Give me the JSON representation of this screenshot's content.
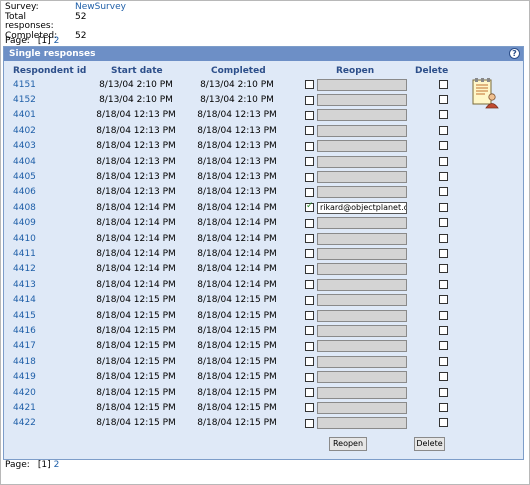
{
  "survey": {
    "survey_label": "Survey:",
    "survey_name": "NewSurvey",
    "total_label": "Total responses:",
    "total_value": "52",
    "completed_label": "Completed:",
    "completed_value": "52"
  },
  "pager_top": {
    "label": "Page:",
    "current": "[1]",
    "next": "2"
  },
  "pager_bottom": {
    "label": "Page:",
    "current": "[1]",
    "next": "2"
  },
  "panel": {
    "title": "Single responses",
    "help_icon": "?"
  },
  "columns": {
    "id": "Respondent id",
    "start": "Start date",
    "completed": "Completed",
    "reopen": "Reopen",
    "delete": "Delete"
  },
  "rows": [
    {
      "id": "4151",
      "start": "8/13/04 2:10 PM",
      "completed": "8/13/04 2:10 PM",
      "reopen_checked": false,
      "email": ""
    },
    {
      "id": "4152",
      "start": "8/13/04 2:10 PM",
      "completed": "8/13/04 2:10 PM",
      "reopen_checked": false,
      "email": ""
    },
    {
      "id": "4401",
      "start": "8/18/04 12:13 PM",
      "completed": "8/18/04 12:13 PM",
      "reopen_checked": false,
      "email": ""
    },
    {
      "id": "4402",
      "start": "8/18/04 12:13 PM",
      "completed": "8/18/04 12:13 PM",
      "reopen_checked": false,
      "email": ""
    },
    {
      "id": "4403",
      "start": "8/18/04 12:13 PM",
      "completed": "8/18/04 12:13 PM",
      "reopen_checked": false,
      "email": ""
    },
    {
      "id": "4404",
      "start": "8/18/04 12:13 PM",
      "completed": "8/18/04 12:13 PM",
      "reopen_checked": false,
      "email": ""
    },
    {
      "id": "4405",
      "start": "8/18/04 12:13 PM",
      "completed": "8/18/04 12:13 PM",
      "reopen_checked": false,
      "email": ""
    },
    {
      "id": "4406",
      "start": "8/18/04 12:13 PM",
      "completed": "8/18/04 12:13 PM",
      "reopen_checked": false,
      "email": ""
    },
    {
      "id": "4408",
      "start": "8/18/04 12:14 PM",
      "completed": "8/18/04 12:14 PM",
      "reopen_checked": true,
      "email": "rikard@objectplanet.com"
    },
    {
      "id": "4409",
      "start": "8/18/04 12:14 PM",
      "completed": "8/18/04 12:14 PM",
      "reopen_checked": false,
      "email": ""
    },
    {
      "id": "4410",
      "start": "8/18/04 12:14 PM",
      "completed": "8/18/04 12:14 PM",
      "reopen_checked": false,
      "email": ""
    },
    {
      "id": "4411",
      "start": "8/18/04 12:14 PM",
      "completed": "8/18/04 12:14 PM",
      "reopen_checked": false,
      "email": ""
    },
    {
      "id": "4412",
      "start": "8/18/04 12:14 PM",
      "completed": "8/18/04 12:14 PM",
      "reopen_checked": false,
      "email": ""
    },
    {
      "id": "4413",
      "start": "8/18/04 12:14 PM",
      "completed": "8/18/04 12:14 PM",
      "reopen_checked": false,
      "email": ""
    },
    {
      "id": "4414",
      "start": "8/18/04 12:15 PM",
      "completed": "8/18/04 12:15 PM",
      "reopen_checked": false,
      "email": ""
    },
    {
      "id": "4415",
      "start": "8/18/04 12:15 PM",
      "completed": "8/18/04 12:15 PM",
      "reopen_checked": false,
      "email": ""
    },
    {
      "id": "4416",
      "start": "8/18/04 12:15 PM",
      "completed": "8/18/04 12:15 PM",
      "reopen_checked": false,
      "email": ""
    },
    {
      "id": "4417",
      "start": "8/18/04 12:15 PM",
      "completed": "8/18/04 12:15 PM",
      "reopen_checked": false,
      "email": ""
    },
    {
      "id": "4418",
      "start": "8/18/04 12:15 PM",
      "completed": "8/18/04 12:15 PM",
      "reopen_checked": false,
      "email": ""
    },
    {
      "id": "4419",
      "start": "8/18/04 12:15 PM",
      "completed": "8/18/04 12:15 PM",
      "reopen_checked": false,
      "email": ""
    },
    {
      "id": "4420",
      "start": "8/18/04 12:15 PM",
      "completed": "8/18/04 12:15 PM",
      "reopen_checked": false,
      "email": ""
    },
    {
      "id": "4421",
      "start": "8/18/04 12:15 PM",
      "completed": "8/18/04 12:15 PM",
      "reopen_checked": false,
      "email": ""
    },
    {
      "id": "4422",
      "start": "8/18/04 12:15 PM",
      "completed": "8/18/04 12:15 PM",
      "reopen_checked": false,
      "email": ""
    }
  ],
  "buttons": {
    "reopen": "Reopen",
    "delete": "Delete"
  },
  "icons": {
    "notepad": "notepad-user-icon"
  },
  "colors": {
    "link": "#1f5fa8",
    "panel_header": "#6d8fc6",
    "panel_bg": "#dfe9f7",
    "column_header": "#2d4f8a"
  }
}
